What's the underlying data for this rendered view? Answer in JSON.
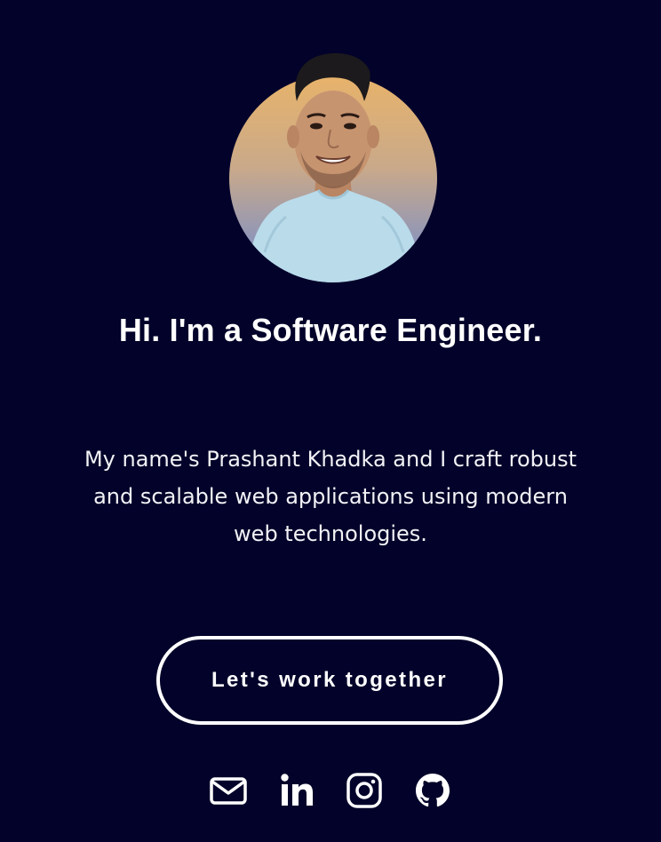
{
  "hero": {
    "avatar_alt": "Portrait photo",
    "headline": "Hi. I'm a Software Engineer.",
    "intro": "My name's Prashant Khadka and I craft robust and scalable web applications using modern web technologies.",
    "cta_label": "Let's work together"
  },
  "socials": [
    {
      "name": "email",
      "icon": "envelope-icon"
    },
    {
      "name": "linkedin",
      "icon": "linkedin-icon"
    },
    {
      "name": "instagram",
      "icon": "instagram-icon"
    },
    {
      "name": "github",
      "icon": "github-icon"
    }
  ],
  "colors": {
    "background": "#02022a",
    "text": "#ffffff",
    "avatar_gradient_top": "#e8b36a",
    "avatar_gradient_bottom": "#7b86b0",
    "shirt": "#b9dbea"
  }
}
